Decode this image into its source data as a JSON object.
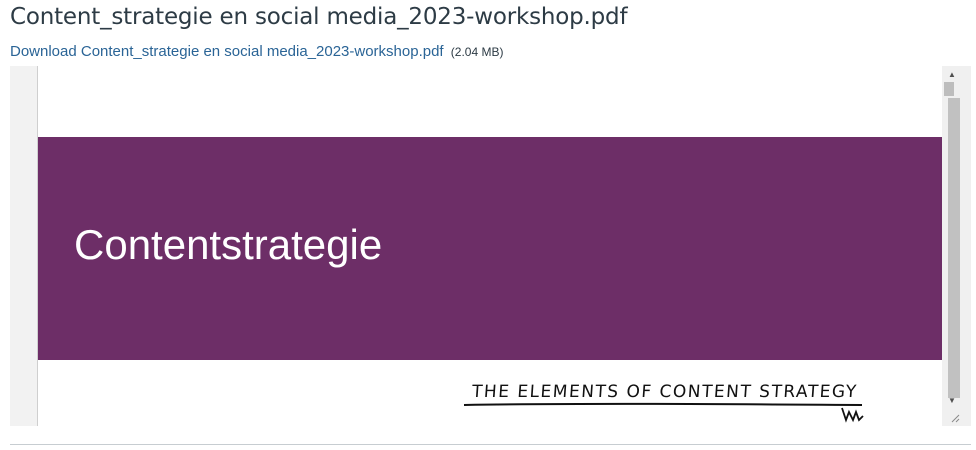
{
  "page": {
    "title": "Content_strategie en social media_2023-workshop.pdf"
  },
  "download": {
    "link_text": "Download Content_strategie en social media_2023-workshop.pdf",
    "file_size": "(2.04 MB)"
  },
  "pdf_viewer": {
    "slide_title": "Contentstrategie",
    "sketch_text": "THE ELEMENTS OF CONTENT STRATEGY"
  },
  "colors": {
    "banner": "#6d2e67",
    "link": "#2a6496",
    "title_text": "#2d3b45"
  },
  "icons": {
    "scroll_up": "triangle-up",
    "scroll_down": "triangle-down",
    "resize": "diagonal-grip"
  }
}
